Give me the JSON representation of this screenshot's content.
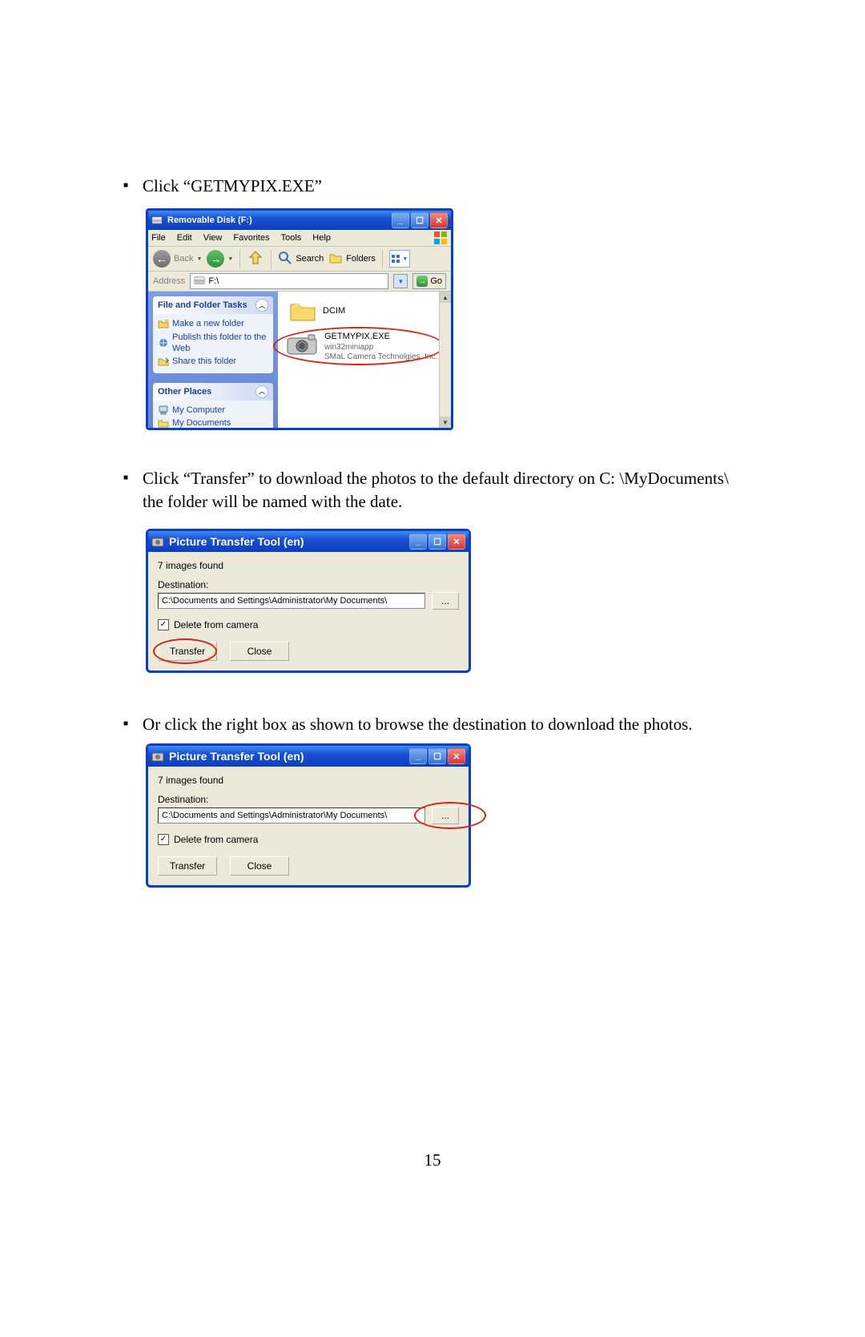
{
  "bullets": {
    "b1": "Click “GETMYPIX.EXE”",
    "b2": "Click “Transfer” to download the photos to the default directory on C: \\MyDocuments\\ the folder will be named with the date.",
    "b3": "Or click the right box as shown to browse the destination to download the photos."
  },
  "explorer": {
    "title": "Removable Disk (F:)",
    "menu": {
      "file": "File",
      "edit": "Edit",
      "view": "View",
      "favorites": "Favorites",
      "tools": "Tools",
      "help": "Help"
    },
    "toolbar": {
      "back": "Back",
      "search": "Search",
      "folders": "Folders"
    },
    "address_label": "Address",
    "address_value": "F:\\",
    "go": "Go",
    "tasks_head": "File and Folder Tasks",
    "tasks": {
      "t1": "Make a new folder",
      "t2": "Publish this folder to the Web",
      "t3": "Share this folder"
    },
    "other_head": "Other Places",
    "other": {
      "o1": "My Computer",
      "o2": "My Documents"
    },
    "file1": "DCIM",
    "file2_name": "GETMYPIX.EXE",
    "file2_sub1": "win32miniapp",
    "file2_sub2": "SMaL Camera Technolgies, Inc."
  },
  "dialog": {
    "title": "Picture Transfer Tool (en)",
    "found": "7 images found",
    "dest_label": "Destination:",
    "dest_value": "C:\\Documents and Settings\\Administrator\\My Documents\\",
    "delete_label": "Delete from camera",
    "browse": "...",
    "transfer": "Transfer",
    "close": "Close"
  },
  "page": "15"
}
